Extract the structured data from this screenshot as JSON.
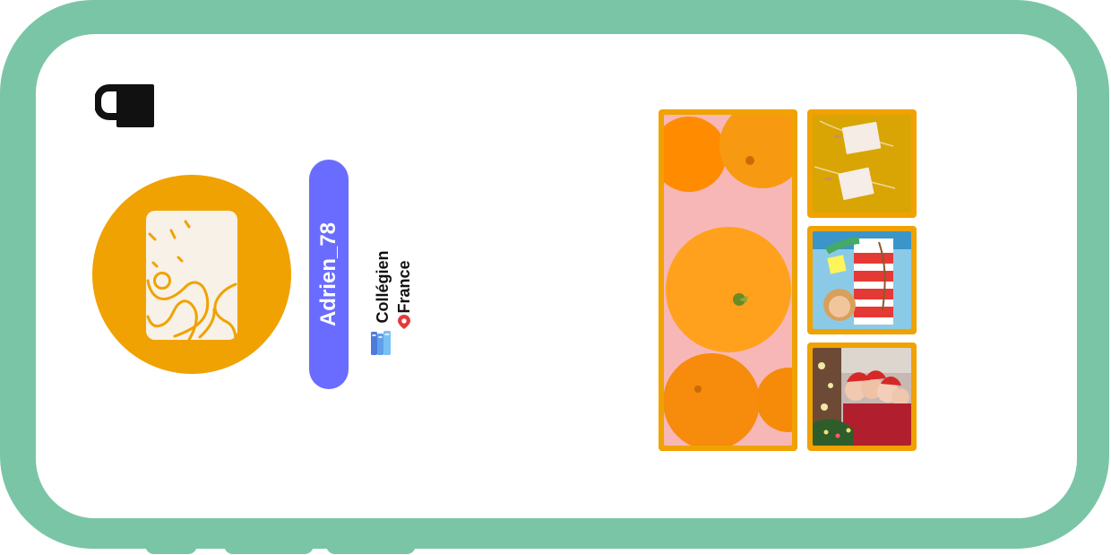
{
  "profile": {
    "username": "Adrien_78",
    "role": "Collégien",
    "country": "France"
  },
  "icons": {
    "lock": "lock-icon",
    "avatar": "landscape-placeholder-icon",
    "books": "books-icon",
    "location": "location-pin-icon"
  },
  "colors": {
    "frame": "#7bc5a7",
    "screen": "#ffffff",
    "accent": "#f0a202",
    "username_pill": "#6a6cff",
    "text": "#111111",
    "location": "#e23b3b"
  },
  "gallery": {
    "images": [
      "orange-fruit-photo",
      "paper-notes-photo",
      "child-drawing-photo",
      "holiday-family-photo"
    ]
  }
}
